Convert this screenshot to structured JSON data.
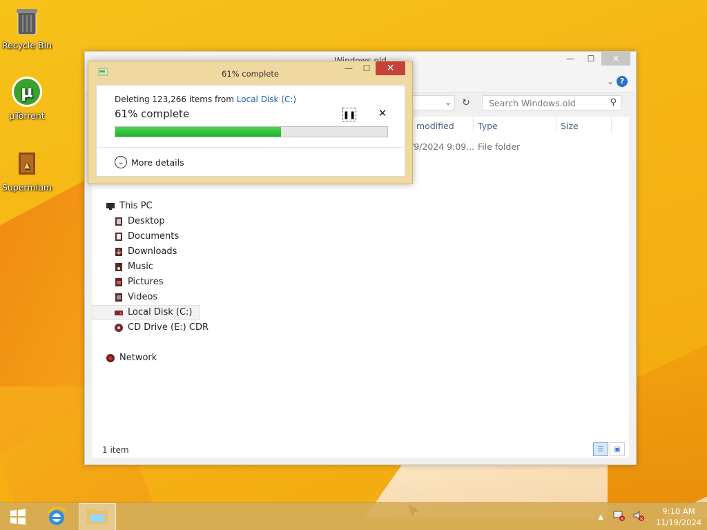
{
  "desktop": {
    "icons": [
      {
        "label": "Recycle Bin",
        "icon": "recycle-bin-icon"
      },
      {
        "label": "µTorrent",
        "icon": "utorrent-icon"
      },
      {
        "label": "Supermium",
        "icon": "supermium-icon"
      }
    ]
  },
  "explorer": {
    "title": "Windows.old",
    "search_placeholder": "Search Windows.old",
    "columns": {
      "modified": "modified",
      "type": "Type",
      "size": "Size"
    },
    "row": {
      "date": "/9/2024 9:09...",
      "type": "File folder"
    },
    "nav": {
      "this_pc": "This PC",
      "items": [
        "Desktop",
        "Documents",
        "Downloads",
        "Music",
        "Pictures",
        "Videos",
        "Local Disk (C:)",
        "CD Drive (E:) CDR"
      ],
      "network": "Network"
    },
    "status": "1 item"
  },
  "dialog": {
    "title": "61% complete",
    "deleting_prefix": "Deleting 123,266 items from ",
    "source_link": "Local Disk (C:)",
    "percent_text": "61% complete",
    "progress": 0.61,
    "more_details": "More details"
  },
  "taskbar": {
    "time": "9:10 AM",
    "date": "11/19/2024"
  },
  "colors": {
    "progress_fill": "#1fb12a",
    "link": "#1a5fb4"
  }
}
